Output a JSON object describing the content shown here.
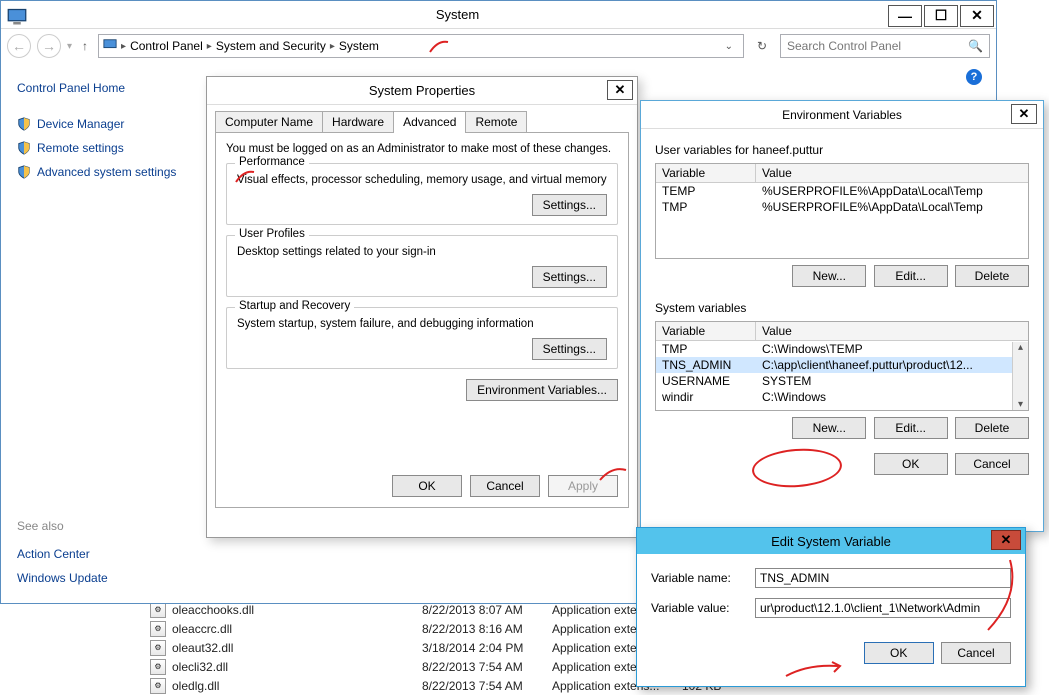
{
  "system_window": {
    "title": "System",
    "breadcrumb": [
      "Control Panel",
      "System and Security",
      "System"
    ],
    "search_placeholder": "Search Control Panel",
    "sidebar": {
      "home": "Control Panel Home",
      "links": [
        "Device Manager",
        "Remote settings",
        "Advanced system settings"
      ],
      "seealso_heading": "See also",
      "seealso": [
        "Action Center",
        "Windows Update"
      ]
    }
  },
  "system_properties": {
    "title": "System Properties",
    "tabs": [
      "Computer Name",
      "Hardware",
      "Advanced",
      "Remote"
    ],
    "active_tab": "Advanced",
    "admin_note": "You must be logged on as an Administrator to make most of these changes.",
    "groups": {
      "performance": {
        "title": "Performance",
        "desc": "Visual effects, processor scheduling, memory usage, and virtual memory",
        "btn": "Settings..."
      },
      "profiles": {
        "title": "User Profiles",
        "desc": "Desktop settings related to your sign-in",
        "btn": "Settings..."
      },
      "startup": {
        "title": "Startup and Recovery",
        "desc": "System startup, system failure, and debugging information",
        "btn": "Settings..."
      }
    },
    "env_btn": "Environment Variables...",
    "footer": {
      "ok": "OK",
      "cancel": "Cancel",
      "apply": "Apply"
    }
  },
  "env_vars": {
    "title": "Environment Variables",
    "user_label": "User variables for haneef.puttur",
    "headers": {
      "var": "Variable",
      "val": "Value"
    },
    "user_rows": [
      {
        "var": "TEMP",
        "val": "%USERPROFILE%\\AppData\\Local\\Temp"
      },
      {
        "var": "TMP",
        "val": "%USERPROFILE%\\AppData\\Local\\Temp"
      }
    ],
    "sys_label": "System variables",
    "sys_rows": [
      {
        "var": "TMP",
        "val": "C:\\Windows\\TEMP"
      },
      {
        "var": "TNS_ADMIN",
        "val": "C:\\app\\client\\haneef.puttur\\product\\12...",
        "selected": true
      },
      {
        "var": "USERNAME",
        "val": "SYSTEM"
      },
      {
        "var": "windir",
        "val": "C:\\Windows"
      }
    ],
    "btns": {
      "new": "New...",
      "edit": "Edit...",
      "delete": "Delete"
    },
    "footer": {
      "ok": "OK",
      "cancel": "Cancel"
    }
  },
  "edit_var": {
    "title": "Edit System Variable",
    "name_label": "Variable name:",
    "value_label": "Variable value:",
    "name": "TNS_ADMIN",
    "value": "ur\\product\\12.1.0\\client_1\\Network\\Admin",
    "footer": {
      "ok": "OK",
      "cancel": "Cancel"
    }
  },
  "filelist": [
    {
      "name": "oleacchooks.dll",
      "date": "8/22/2013 8:07 AM",
      "type": "Application extens...",
      "size": ""
    },
    {
      "name": "oleaccrc.dll",
      "date": "8/22/2013 8:16 AM",
      "type": "Application extens...",
      "size": ""
    },
    {
      "name": "oleaut32.dll",
      "date": "3/18/2014 2:04 PM",
      "type": "Application extens...",
      "size": ""
    },
    {
      "name": "olecli32.dll",
      "date": "8/22/2013 7:54 AM",
      "type": "Application extens...",
      "size": ""
    },
    {
      "name": "oledlg.dll",
      "date": "8/22/2013 7:54 AM",
      "type": "Application extens...",
      "size": "102 KB"
    }
  ]
}
